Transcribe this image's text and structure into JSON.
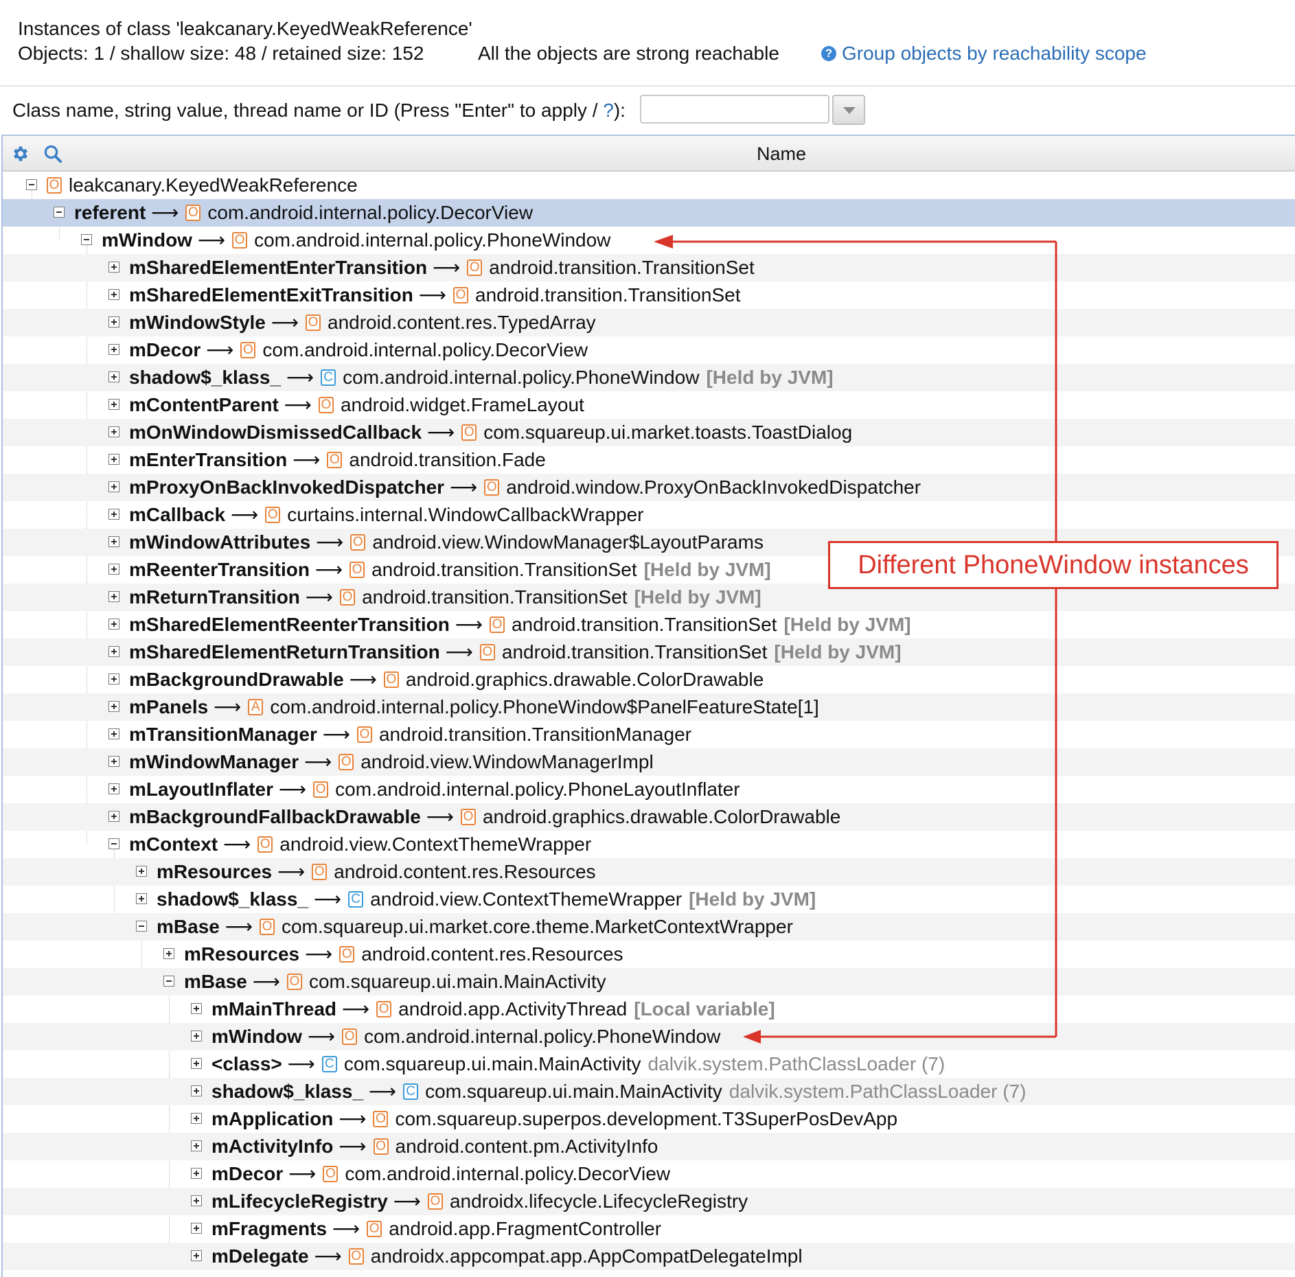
{
  "header": {
    "title": "Instances of class 'leakcanary.KeyedWeakReference'",
    "stats": "Objects: 1 / shallow size: 48 / retained size: 152",
    "reachability": "All the objects are strong reachable",
    "group_link": "Group objects by reachability scope"
  },
  "filter": {
    "label": "Class name, string value, thread name or ID  (Press \"Enter\" to apply / ",
    "help": "?",
    "label_end": "):",
    "value": ""
  },
  "columns": {
    "name": "Name"
  },
  "annotation": {
    "text": "Different PhoneWindow instances",
    "color": "#d9352b"
  },
  "rows": [
    {
      "depth": 0,
      "toggle": "minus",
      "field": "",
      "kind": "O",
      "type": "leakcanary.KeyedWeakReference",
      "suffix": ""
    },
    {
      "depth": 1,
      "toggle": "minus",
      "field": "referent",
      "kind": "O",
      "type": "com.android.internal.policy.DecorView",
      "suffix": "",
      "selected": true
    },
    {
      "depth": 2,
      "toggle": "minus",
      "field": "mWindow",
      "kind": "O",
      "type": "com.android.internal.policy.PhoneWindow",
      "suffix": ""
    },
    {
      "depth": 3,
      "toggle": "plus",
      "field": "mSharedElementEnterTransition",
      "kind": "O",
      "type": "android.transition.TransitionSet",
      "suffix": ""
    },
    {
      "depth": 3,
      "toggle": "plus",
      "field": "mSharedElementExitTransition",
      "kind": "O",
      "type": "android.transition.TransitionSet",
      "suffix": ""
    },
    {
      "depth": 3,
      "toggle": "plus",
      "field": "mWindowStyle",
      "kind": "O",
      "type": "android.content.res.TypedArray",
      "suffix": ""
    },
    {
      "depth": 3,
      "toggle": "plus",
      "field": "mDecor",
      "kind": "O",
      "type": "com.android.internal.policy.DecorView",
      "suffix": ""
    },
    {
      "depth": 3,
      "toggle": "plus",
      "field": "shadow$_klass_",
      "kind": "C",
      "type": "com.android.internal.policy.PhoneWindow",
      "suffix": "[Held by JVM]",
      "suffix_bold": true
    },
    {
      "depth": 3,
      "toggle": "plus",
      "field": "mContentParent",
      "kind": "O",
      "type": "android.widget.FrameLayout",
      "suffix": ""
    },
    {
      "depth": 3,
      "toggle": "plus",
      "field": "mOnWindowDismissedCallback",
      "kind": "O",
      "type": "com.squareup.ui.market.toasts.ToastDialog",
      "suffix": ""
    },
    {
      "depth": 3,
      "toggle": "plus",
      "field": "mEnterTransition",
      "kind": "O",
      "type": "android.transition.Fade",
      "suffix": ""
    },
    {
      "depth": 3,
      "toggle": "plus",
      "field": "mProxyOnBackInvokedDispatcher",
      "kind": "O",
      "type": "android.window.ProxyOnBackInvokedDispatcher",
      "suffix": ""
    },
    {
      "depth": 3,
      "toggle": "plus",
      "field": "mCallback",
      "kind": "O",
      "type": "curtains.internal.WindowCallbackWrapper",
      "suffix": ""
    },
    {
      "depth": 3,
      "toggle": "plus",
      "field": "mWindowAttributes",
      "kind": "O",
      "type": "android.view.WindowManager$LayoutParams",
      "suffix": ""
    },
    {
      "depth": 3,
      "toggle": "plus",
      "field": "mReenterTransition",
      "kind": "O",
      "type": "android.transition.TransitionSet",
      "suffix": "[Held by JVM]",
      "suffix_bold": true
    },
    {
      "depth": 3,
      "toggle": "plus",
      "field": "mReturnTransition",
      "kind": "O",
      "type": "android.transition.TransitionSet",
      "suffix": "[Held by JVM]",
      "suffix_bold": true
    },
    {
      "depth": 3,
      "toggle": "plus",
      "field": "mSharedElementReenterTransition",
      "kind": "O",
      "type": "android.transition.TransitionSet",
      "suffix": "[Held by JVM]",
      "suffix_bold": true
    },
    {
      "depth": 3,
      "toggle": "plus",
      "field": "mSharedElementReturnTransition",
      "kind": "O",
      "type": "android.transition.TransitionSet",
      "suffix": "[Held by JVM]",
      "suffix_bold": true
    },
    {
      "depth": 3,
      "toggle": "plus",
      "field": "mBackgroundDrawable",
      "kind": "O",
      "type": "android.graphics.drawable.ColorDrawable",
      "suffix": ""
    },
    {
      "depth": 3,
      "toggle": "plus",
      "field": "mPanels",
      "kind": "A",
      "type": "com.android.internal.policy.PhoneWindow$PanelFeatureState[1]",
      "suffix": ""
    },
    {
      "depth": 3,
      "toggle": "plus",
      "field": "mTransitionManager",
      "kind": "O",
      "type": "android.transition.TransitionManager",
      "suffix": ""
    },
    {
      "depth": 3,
      "toggle": "plus",
      "field": "mWindowManager",
      "kind": "O",
      "type": "android.view.WindowManagerImpl",
      "suffix": ""
    },
    {
      "depth": 3,
      "toggle": "plus",
      "field": "mLayoutInflater",
      "kind": "O",
      "type": "com.android.internal.policy.PhoneLayoutInflater",
      "suffix": ""
    },
    {
      "depth": 3,
      "toggle": "plus",
      "field": "mBackgroundFallbackDrawable",
      "kind": "O",
      "type": "android.graphics.drawable.ColorDrawable",
      "suffix": ""
    },
    {
      "depth": 3,
      "toggle": "minus",
      "field": "mContext",
      "kind": "O",
      "type": "android.view.ContextThemeWrapper",
      "suffix": ""
    },
    {
      "depth": 4,
      "toggle": "plus",
      "field": "mResources",
      "kind": "O",
      "type": "android.content.res.Resources",
      "suffix": ""
    },
    {
      "depth": 4,
      "toggle": "plus",
      "field": "shadow$_klass_",
      "kind": "C",
      "type": "android.view.ContextThemeWrapper",
      "suffix": "[Held by JVM]",
      "suffix_bold": true
    },
    {
      "depth": 4,
      "toggle": "minus",
      "field": "mBase",
      "kind": "O",
      "type": "com.squareup.ui.market.core.theme.MarketContextWrapper",
      "suffix": ""
    },
    {
      "depth": 5,
      "toggle": "plus",
      "field": "mResources",
      "kind": "O",
      "type": "android.content.res.Resources",
      "suffix": ""
    },
    {
      "depth": 5,
      "toggle": "minus",
      "field": "mBase",
      "kind": "O",
      "type": "com.squareup.ui.main.MainActivity",
      "suffix": ""
    },
    {
      "depth": 6,
      "toggle": "plus",
      "field": "mMainThread",
      "kind": "O",
      "type": "android.app.ActivityThread",
      "suffix": "[Local variable]",
      "suffix_bold": true
    },
    {
      "depth": 6,
      "toggle": "plus",
      "field": "mWindow",
      "kind": "O",
      "type": "com.android.internal.policy.PhoneWindow",
      "suffix": ""
    },
    {
      "depth": 6,
      "toggle": "plus",
      "field": "<class>",
      "kind": "C",
      "type": "com.squareup.ui.main.MainActivity",
      "suffix": "dalvik.system.PathClassLoader (7)",
      "suffix_bold": false
    },
    {
      "depth": 6,
      "toggle": "plus",
      "field": "shadow$_klass_",
      "kind": "C",
      "type": "com.squareup.ui.main.MainActivity",
      "suffix": "dalvik.system.PathClassLoader (7)",
      "suffix_bold": false
    },
    {
      "depth": 6,
      "toggle": "plus",
      "field": "mApplication",
      "kind": "O",
      "type": "com.squareup.superpos.development.T3SuperPosDevApp",
      "suffix": ""
    },
    {
      "depth": 6,
      "toggle": "plus",
      "field": "mActivityInfo",
      "kind": "O",
      "type": "android.content.pm.ActivityInfo",
      "suffix": ""
    },
    {
      "depth": 6,
      "toggle": "plus",
      "field": "mDecor",
      "kind": "O",
      "type": "com.android.internal.policy.DecorView",
      "suffix": ""
    },
    {
      "depth": 6,
      "toggle": "plus",
      "field": "mLifecycleRegistry",
      "kind": "O",
      "type": "androidx.lifecycle.LifecycleRegistry",
      "suffix": ""
    },
    {
      "depth": 6,
      "toggle": "plus",
      "field": "mFragments",
      "kind": "O",
      "type": "android.app.FragmentController",
      "suffix": ""
    },
    {
      "depth": 6,
      "toggle": "plus",
      "field": "mDelegate",
      "kind": "O",
      "type": "androidx.appcompat.app.AppCompatDelegateImpl",
      "suffix": ""
    }
  ]
}
